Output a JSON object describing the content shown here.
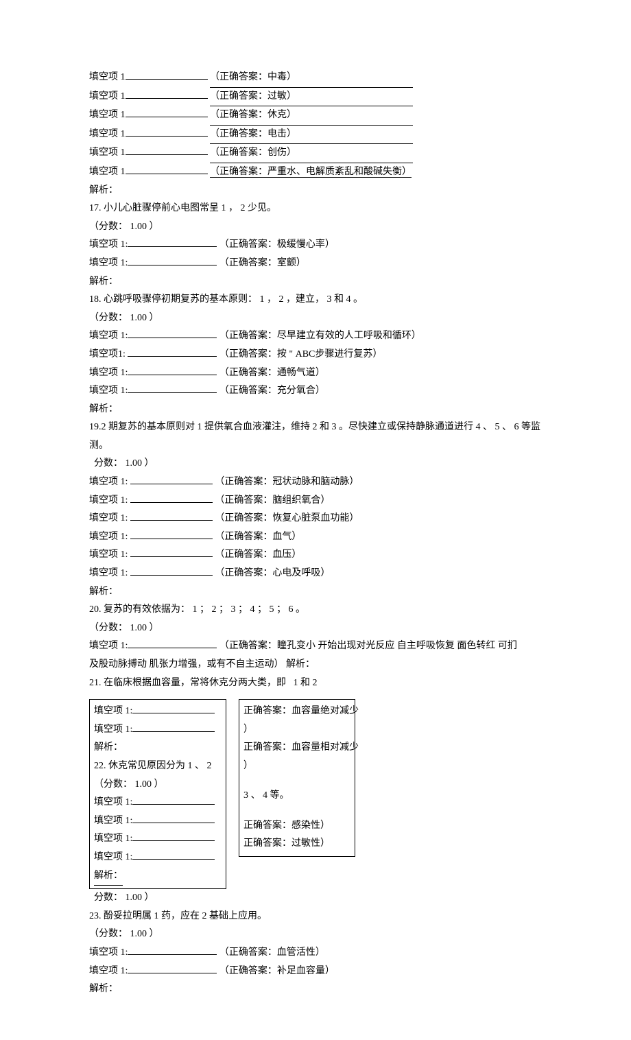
{
  "pre16": {
    "b1": {
      "label": "填空项 1",
      "answer": "（正确答案：中毒）"
    },
    "b2": {
      "label": "填空项 1",
      "answer": "（正确答案：过敏）"
    },
    "b3": {
      "label": "填空项 1",
      "answer": "（正确答案：休克）"
    },
    "b4": {
      "label": "填空项 1",
      "answer": "（正确答案：电击）"
    },
    "b5": {
      "label": "填空项 1",
      "answer": "（正确答案：创伤）"
    },
    "b6": {
      "label": "填空项 1",
      "answer": "（正确答案：严重水、电解质紊乱和酸碱失衡）"
    },
    "analysis": "解析："
  },
  "q17": {
    "stem": "17. 小儿心脏骤停前心电图常呈  1 ，  2 少见。",
    "score": "（分数：  1.00 ）",
    "b1": {
      "label": "填空项 1:",
      "answer": "（正确答案：极缓慢心率）"
    },
    "b2": {
      "label": "填空项 1:",
      "answer": "（正确答案：室颤）"
    },
    "analysis": "解析："
  },
  "q18": {
    "stem": "18. 心跳呼吸骤停初期复苏的基本原则：  1 ， 2 ，建立，  3 和 4 。",
    "score": "（分数：  1.00 ）",
    "b1": {
      "label": "填空项 1:",
      "answer": "（正确答案：尽早建立有效的人工呼吸和循环）"
    },
    "b2": {
      "label": "填空项1:",
      "answer": "（正确答案：按 \" ABC步骤进行复苏）"
    },
    "b3": {
      "label": "填空项 1:",
      "answer": "（正确答案：通畅气道）"
    },
    "b4": {
      "label": "填空项 1:",
      "answer": "（正确答案：充分氧合）"
    },
    "analysis": "解析："
  },
  "q19": {
    "stem": "19.2 期复苏的基本原则对 1 提供氧合血液灌注，维持  2 和 3 。尽快建立或保持静脉通道进行  4 、 5 、 6 等监测。",
    "score": "分数： 1.00 ）",
    "b1": {
      "label": "填空项   1:",
      "answer": "（正确答案：冠状动脉和脑动脉）"
    },
    "b2": {
      "label": "填空项   1:",
      "answer": "（正确答案：脑组织氧合）"
    },
    "b3": {
      "label": "填空项   1:",
      "answer": "（正确答案：恢复心脏泵血功能）"
    },
    "b4": {
      "label": "填空项   1:",
      "answer": "（正确答案：血气）"
    },
    "b5": {
      "label": "填空项   1:",
      "answer": "（正确答案：血压）"
    },
    "b6": {
      "label": "填空项   1:",
      "answer": "（正确答案：心电及呼吸）"
    },
    "analysis": "解析："
  },
  "q20": {
    "stem": "20.  复苏的有效依据为：  1 ； 2 ； 3 ； 4 ； 5 ； 6 。",
    "score": "（分数：  1.00 ）",
    "b1": {
      "label": "填空项 1:",
      "answer": "（正确答案：瞳孔变小 开始出现对光反应 自主呼吸恢复 面色转红 可扪"
    },
    "cont": "及股动脉搏动 肌张力增强，或有不自主运动） 解析："
  },
  "q21": {
    "stem": "21.  在临床根据血容量，常将休克分两大类，即",
    "tail": "1 和 2"
  },
  "boxL": {
    "b1": "填空项 1:",
    "b2": "填空项 1:",
    "an": "解析：",
    "q22": "22. 休克常见原因分为 1 、 2",
    "score": "（分数：  1.00 ）",
    "b3": "填空项 1:",
    "b4": "填空项 1:",
    "b5": "填空项 1:",
    "b6": "填空项 1:",
    "an2": "解析："
  },
  "boxR": {
    "r1": "正确答案：血容量绝对减少",
    "r2": "）",
    "r3": "正确答案：血容量相对减少",
    "r4": "）",
    "r5": "3 、 4 等。",
    "r6": "正确答案：感染性）",
    "r7": "正确答案：过敏性）"
  },
  "post": {
    "score22": "分数：  1.00 ）"
  },
  "q23": {
    "stem": "23.  酚妥拉明属  1 药，应在  2 基础上应用。",
    "score": "（分数：  1.00 ）",
    "b1": {
      "label": "填空项 1:",
      "answer": "（正确答案：血管活性）"
    },
    "b2": {
      "label": "填空项 1:",
      "answer": "（正确答案：补足血容量）"
    },
    "analysis": "解析："
  }
}
